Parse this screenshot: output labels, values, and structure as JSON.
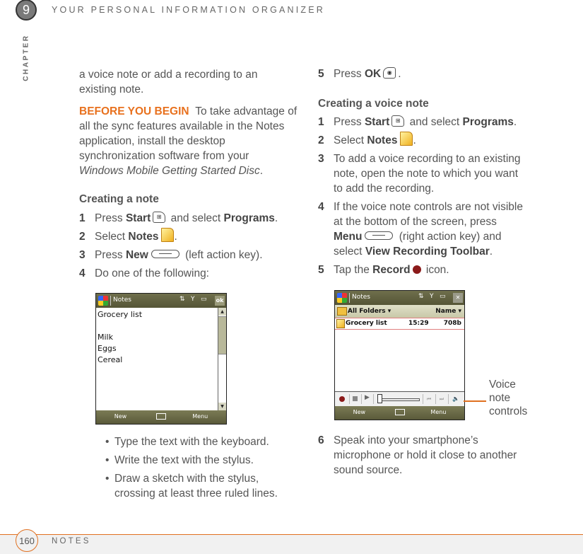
{
  "header": {
    "chapter_number": "9",
    "chapter_label": "CHAPTER",
    "title": "YOUR PERSONAL INFORMATION ORGANIZER"
  },
  "footer": {
    "page_number": "160",
    "section": "NOTES"
  },
  "left_column": {
    "intro_line1": "a voice note or add a recording to an",
    "intro_line2": "existing note.",
    "before_label": "BEFORE YOU BEGIN",
    "before_text_line1": "To take advantage of",
    "before_text_line2": "all the sync features available in the Notes",
    "before_text_line3": "application, install the desktop",
    "before_text_line4": "synchronization software from your",
    "before_text_line5": "Windows Mobile Getting Started Disc",
    "heading": "Creating a note",
    "steps": [
      {
        "num": "1",
        "pre": "Press ",
        "bold1": "Start",
        "mid": " and select ",
        "bold2": "Programs",
        "post": "."
      },
      {
        "num": "2",
        "pre": "Select ",
        "bold1": "Notes",
        "post": "."
      },
      {
        "num": "3",
        "pre": "Press ",
        "bold1": "New",
        "post": " (left action key)."
      },
      {
        "num": "4",
        "text": "Do one of the following:"
      }
    ],
    "bullets": [
      "Type the text with the keyboard.",
      "Write the text with the stylus.",
      "Draw a sketch with the stylus,",
      "crossing at least three ruled lines."
    ]
  },
  "screen1": {
    "app_title": "Notes",
    "ok_label": "ok",
    "lines": [
      "Grocery list",
      "",
      "Milk",
      "Eggs",
      "Cereal"
    ],
    "soft_left": "New",
    "soft_right": "Menu"
  },
  "right_column": {
    "step5": {
      "num": "5",
      "pre": "Press ",
      "bold1": "OK",
      "post": "."
    },
    "heading": "Creating a voice note",
    "steps": [
      {
        "num": "1",
        "pre": "Press ",
        "bold1": "Start",
        "mid": " and select ",
        "bold2": "Programs",
        "post": "."
      },
      {
        "num": "2",
        "pre": "Select ",
        "bold1": "Notes",
        "post": "."
      },
      {
        "num": "3",
        "line1": "To add a voice recording to an existing",
        "line2": "note, open the note to which you want",
        "line3": "to add the recording."
      },
      {
        "num": "4",
        "line1": "If the voice note controls are not visible",
        "line2": "at the bottom of the screen, press",
        "bold1": "Menu",
        "line3_post": " (right action key) and",
        "line4_pre": "select ",
        "bold2": "View Recording Toolbar",
        "line4_post": "."
      },
      {
        "num": "5",
        "pre": "Tap the ",
        "bold1": "Record",
        "post": " icon."
      },
      {
        "num": "6",
        "line1": "Speak into your smartphone’s",
        "line2": "microphone or hold it close to another",
        "line3": "sound source."
      }
    ]
  },
  "screen2": {
    "app_title": "Notes",
    "folder": "All Folders",
    "sort": "Name",
    "row": {
      "name": "Grocery list",
      "time": "15:29",
      "size": "708b"
    },
    "soft_left": "New",
    "soft_right": "Menu",
    "callout": [
      "Voice",
      "note",
      "controls"
    ]
  }
}
